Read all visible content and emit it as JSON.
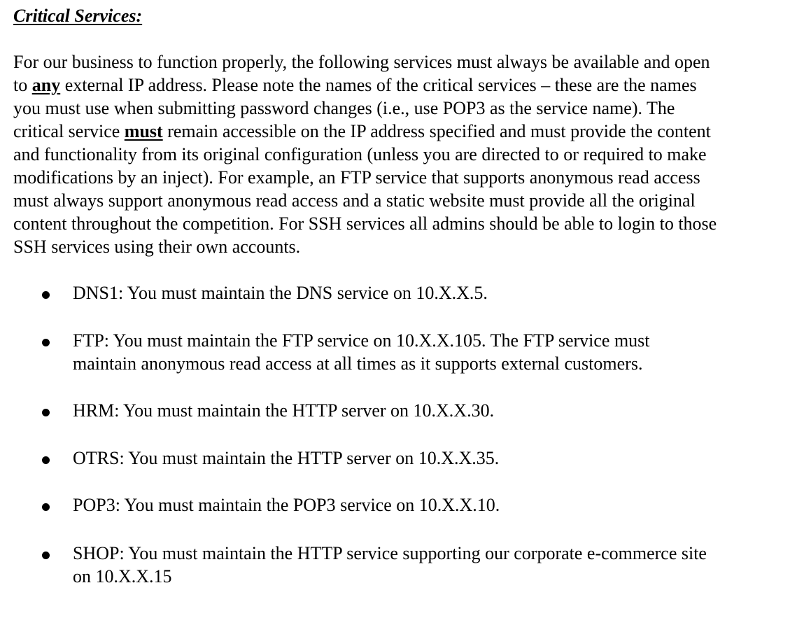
{
  "heading": "Critical Services:",
  "intro": {
    "line1": "For our business to function properly, the following services must always be available and open",
    "line2_a": "to ",
    "line2_emph": "any",
    "line2_b": " external IP address.  Please note the names of the critical services – these are the names",
    "line3": "you must use when submitting password changes (i.e., use POP3 as the service name).  The",
    "line4_a": "critical service ",
    "line4_emph": "must",
    "line4_b": " remain accessible on the IP address specified and must provide the content",
    "line5": "and functionality from its original configuration (unless you are directed to or required to make",
    "line6": "modifications by an inject).  For example, an FTP service that supports anonymous read access",
    "line7": "must always support anonymous read access and a static website must provide all the original",
    "line8": "content throughout the competition.  For SSH services all admins should be able to login to those",
    "line9": "SSH services using their own accounts."
  },
  "services": [
    {
      "line1": "DNS1:  You must maintain the DNS service on 10.X.X.5.",
      "line2": ""
    },
    {
      "line1": "FTP:  You must maintain the FTP service on 10.X.X.105.  The FTP service must",
      "line2": "maintain anonymous read access at all times as it supports external customers."
    },
    {
      "line1": "HRM:  You must maintain the HTTP server on 10.X.X.30.",
      "line2": ""
    },
    {
      "line1": "OTRS:  You must maintain the HTTP server on 10.X.X.35.",
      "line2": ""
    },
    {
      "line1": "POP3:  You must maintain the POP3 service on 10.X.X.10.",
      "line2": ""
    },
    {
      "line1": "SHOP:  You must maintain the HTTP service supporting our corporate e-commerce site",
      "line2": "on 10.X.X.15"
    }
  ]
}
